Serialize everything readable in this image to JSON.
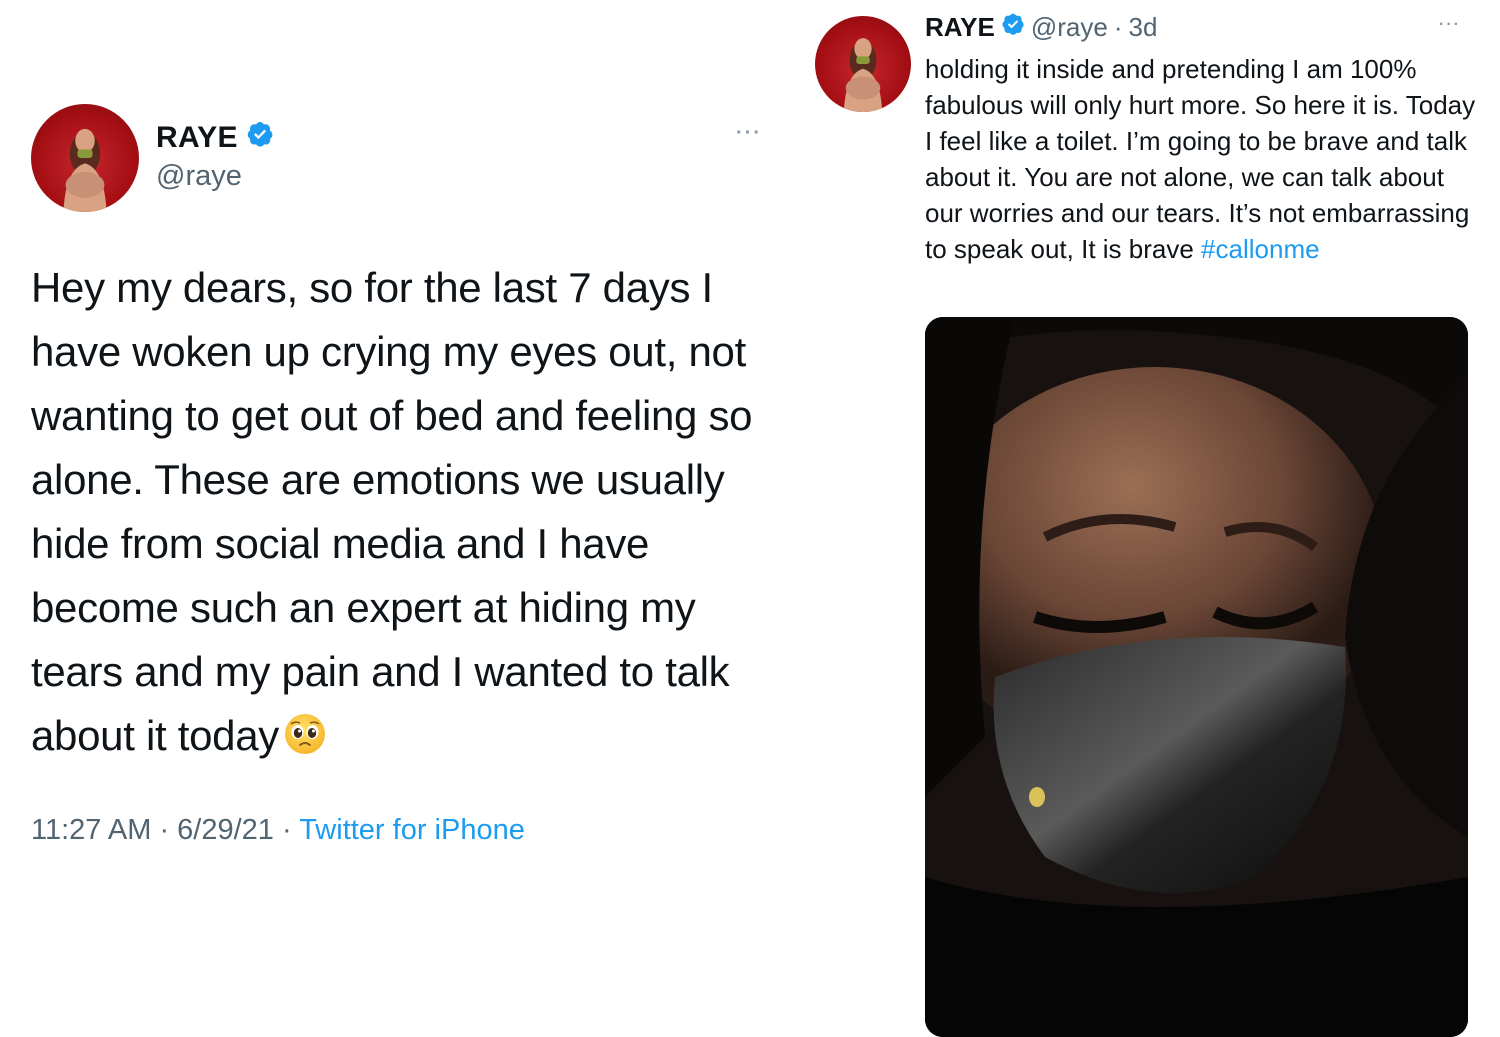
{
  "left_tweet": {
    "display_name": "RAYE",
    "handle": "@raye",
    "more_label": "···",
    "text": "Hey my dears, so for the last 7 days I have woken up crying my eyes out, not wanting to get out of bed and feeling so alone. These are emotions we usually hide from social media and I have become such an expert at hiding my tears and my pain and I wanted to talk about it today",
    "emoji": "pleading-face-emoji",
    "time": "11:27 AM",
    "date": "6/29/21",
    "separator": " · ",
    "source": "Twitter for iPhone"
  },
  "right_tweet": {
    "display_name": "RAYE",
    "handle": "@raye",
    "dot": "·",
    "time_ago": "3d",
    "more_label": "···",
    "text": "holding it inside and pretending I am 100% fabulous will only hurt more. So here it is. Today I feel like a toilet. I’m going to be brave and talk about it. You are not alone, we can talk about our worries and our tears. It’s not embarrassing to speak out, It is brave ",
    "hashtag": "#callonme"
  },
  "colors": {
    "text": "#0f1419",
    "secondary": "#536471",
    "link": "#1d9bf0",
    "verified": "#1d9bf0",
    "avatar_bg": "#a50f14"
  },
  "icons": [
    "verified-badge-icon",
    "more-options-icon",
    "pleading-face-emoji"
  ]
}
